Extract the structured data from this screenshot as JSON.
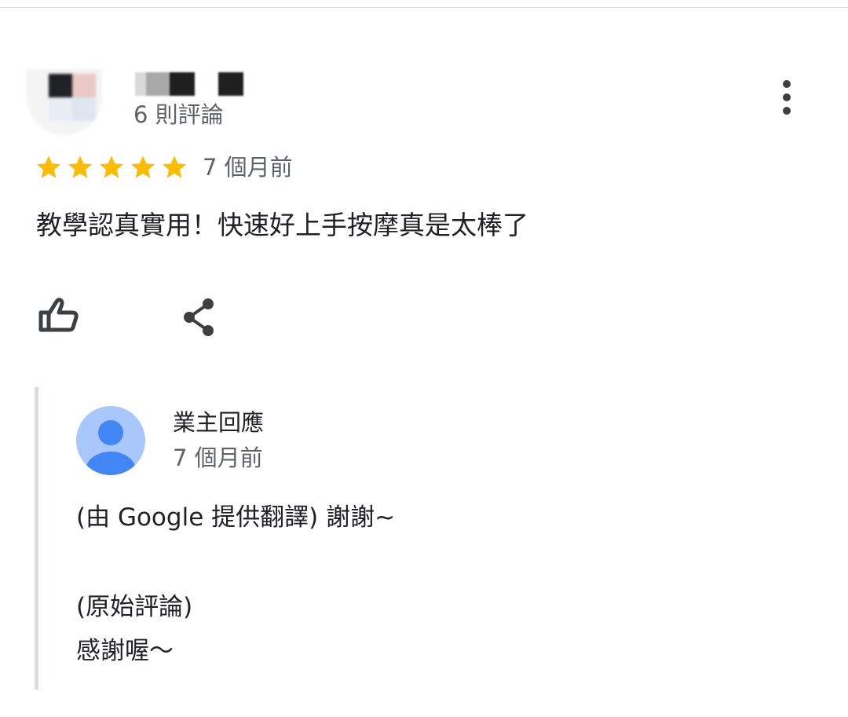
{
  "review": {
    "author_review_count": "6 則評論",
    "rating": 5,
    "rating_max": 5,
    "time": "7 個月前",
    "text": "教學認真實用！快速好上手按摩真是太棒了",
    "icons": {
      "more": "more-vert-icon",
      "like": "thumb-up-icon",
      "share": "share-icon",
      "star": "star-icon"
    }
  },
  "owner_response": {
    "label": "業主回應",
    "time": "7 個月前",
    "translated_text": "(由 Google 提供翻譯) 謝謝~",
    "original_heading": "(原始評論)",
    "original_text": "感謝喔～",
    "avatar_icon": "person-icon"
  },
  "colors": {
    "star": "#fbbc04",
    "secondary_text": "#5f6368",
    "primary_text": "#202124",
    "owner_avatar_bg": "#a8c7fa",
    "owner_avatar_fg": "#4285f4",
    "divider": "#dadce0"
  }
}
